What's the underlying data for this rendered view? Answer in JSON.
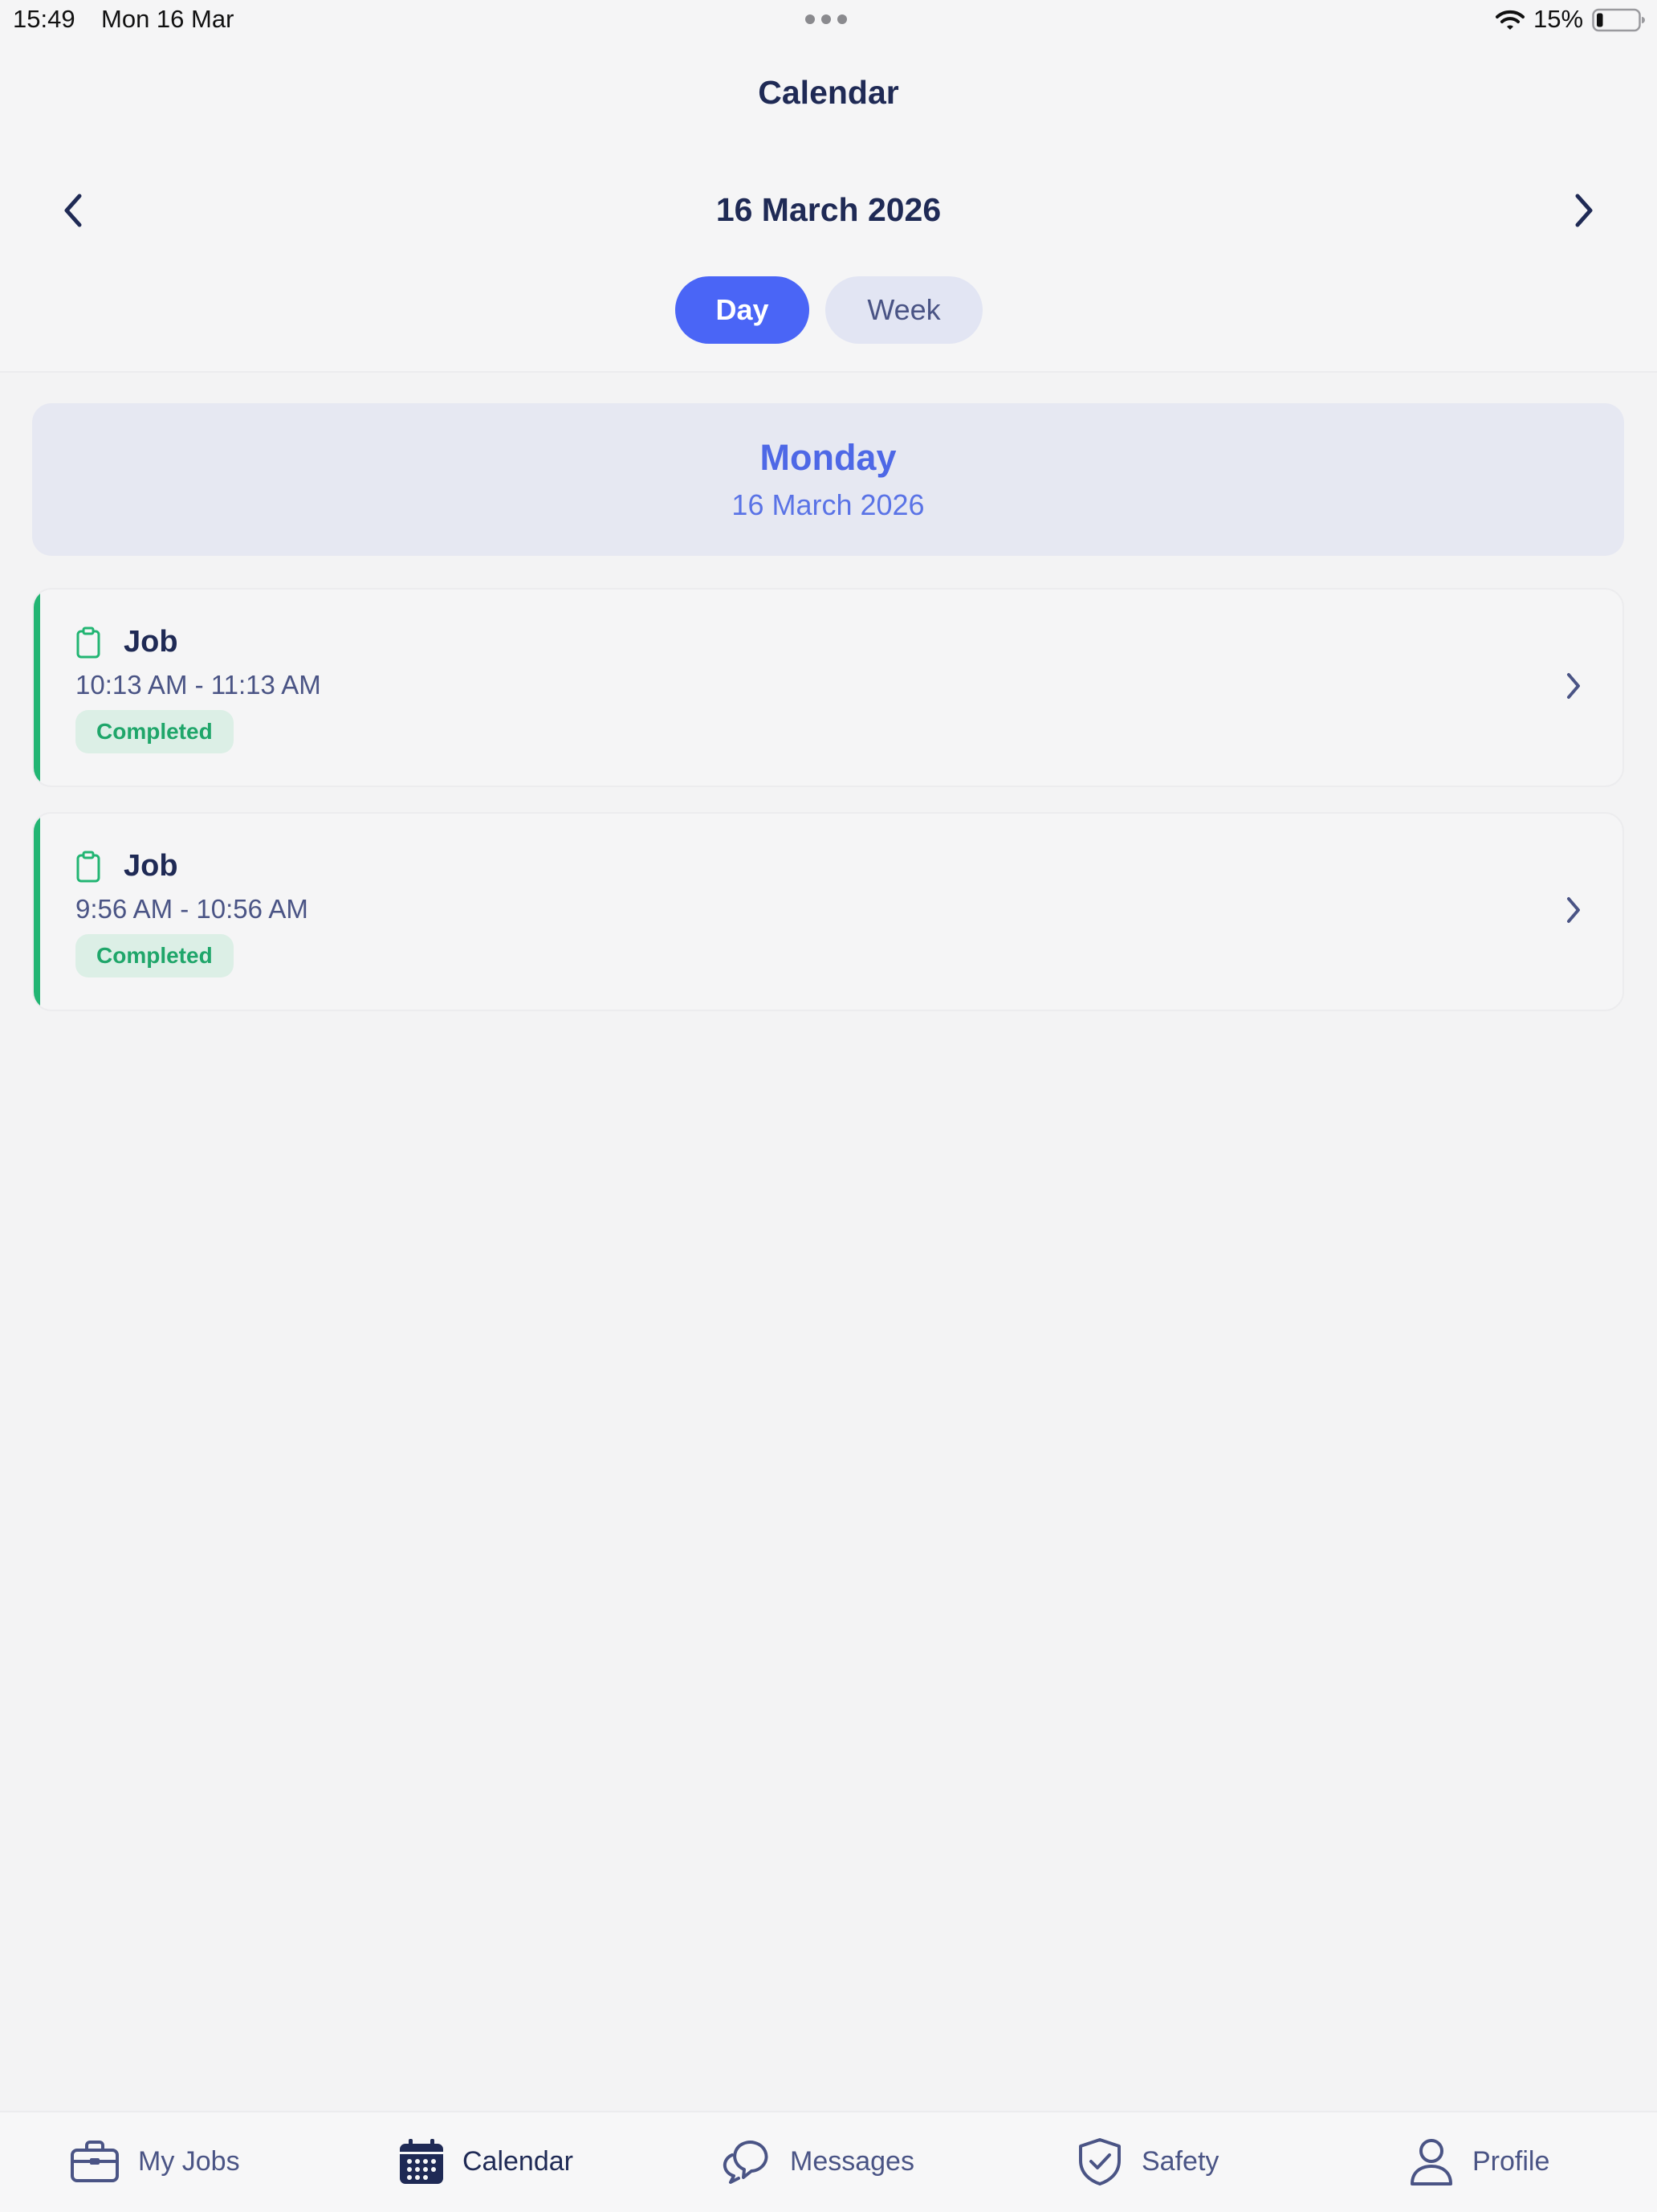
{
  "status_bar": {
    "time": "15:49",
    "date": "Mon 16 Mar",
    "battery_percent": "15%",
    "battery_level": 0.15
  },
  "header": {
    "title": "Calendar",
    "current_date": "16 March 2026",
    "prev_icon": "chevron-left-icon",
    "next_icon": "chevron-right-icon"
  },
  "view_toggle": {
    "options": [
      "Day",
      "Week"
    ],
    "selected": "Day"
  },
  "day_banner": {
    "weekday": "Monday",
    "date": "16 March 2026"
  },
  "jobs": [
    {
      "title": "Job",
      "time_range": "10:13 AM - 11:13 AM",
      "status": "Completed",
      "icon": "clipboard-icon"
    },
    {
      "title": "Job",
      "time_range": "9:56 AM - 10:56 AM",
      "status": "Completed",
      "icon": "clipboard-icon"
    }
  ],
  "tab_bar": {
    "tabs": [
      {
        "label": "My Jobs",
        "icon": "briefcase-icon"
      },
      {
        "label": "Calendar",
        "icon": "calendar-icon"
      },
      {
        "label": "Messages",
        "icon": "chat-bubbles-icon"
      },
      {
        "label": "Safety",
        "icon": "shield-check-icon"
      },
      {
        "label": "Profile",
        "icon": "person-icon"
      }
    ],
    "active": "Calendar"
  },
  "colors": {
    "accent": "#4a65f6",
    "navy": "#1f2a55",
    "completed_green": "#22b573",
    "completed_badge_bg": "#dcefe6",
    "banner_bg": "#e6e8f2"
  }
}
